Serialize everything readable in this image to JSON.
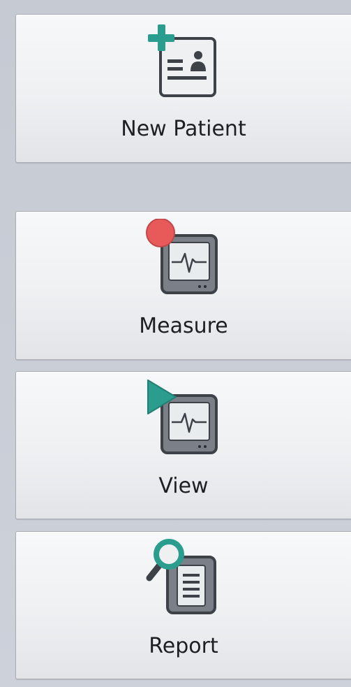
{
  "sidebar": {
    "buttons": [
      {
        "label": "New Patient",
        "icon": "patient-card-add-icon"
      },
      {
        "label": "Measure",
        "icon": "monitor-record-icon"
      },
      {
        "label": "View",
        "icon": "monitor-play-icon"
      },
      {
        "label": "Report",
        "icon": "report-search-icon"
      }
    ]
  },
  "colors": {
    "accent_teal": "#2a9d8f",
    "record_red": "#e85a5a",
    "icon_dark": "#3d4148",
    "icon_screen": "#e9ecef"
  }
}
